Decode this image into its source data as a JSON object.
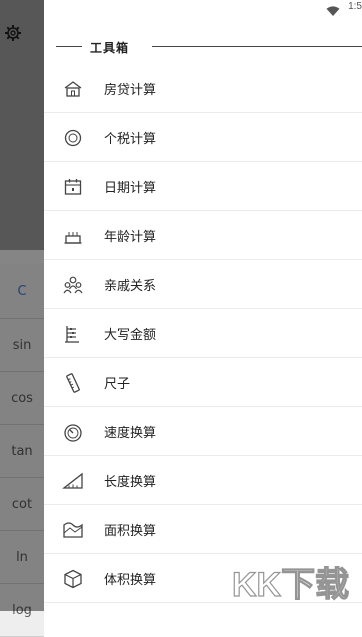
{
  "status_bar": {
    "time": "1:5"
  },
  "background": {
    "keys": [
      "C",
      "sin",
      "cos",
      "tan",
      "cot",
      "ln",
      "log"
    ]
  },
  "drawer": {
    "title": "工具箱",
    "items": [
      {
        "label": "房贷计算",
        "icon": "house-icon"
      },
      {
        "label": "个税计算",
        "icon": "tax-coin-icon"
      },
      {
        "label": "日期计算",
        "icon": "calendar-icon"
      },
      {
        "label": "年龄计算",
        "icon": "birthday-cake-icon"
      },
      {
        "label": "亲戚关系",
        "icon": "family-icon"
      },
      {
        "label": "大写金额",
        "icon": "abacus-icon"
      },
      {
        "label": "尺子",
        "icon": "ruler-icon"
      },
      {
        "label": "速度换算",
        "icon": "speedometer-icon"
      },
      {
        "label": "长度换算",
        "icon": "length-ruler-icon"
      },
      {
        "label": "面积换算",
        "icon": "area-icon"
      },
      {
        "label": "体积换算",
        "icon": "cube-icon"
      }
    ]
  },
  "watermark": {
    "text": "KK下载"
  }
}
